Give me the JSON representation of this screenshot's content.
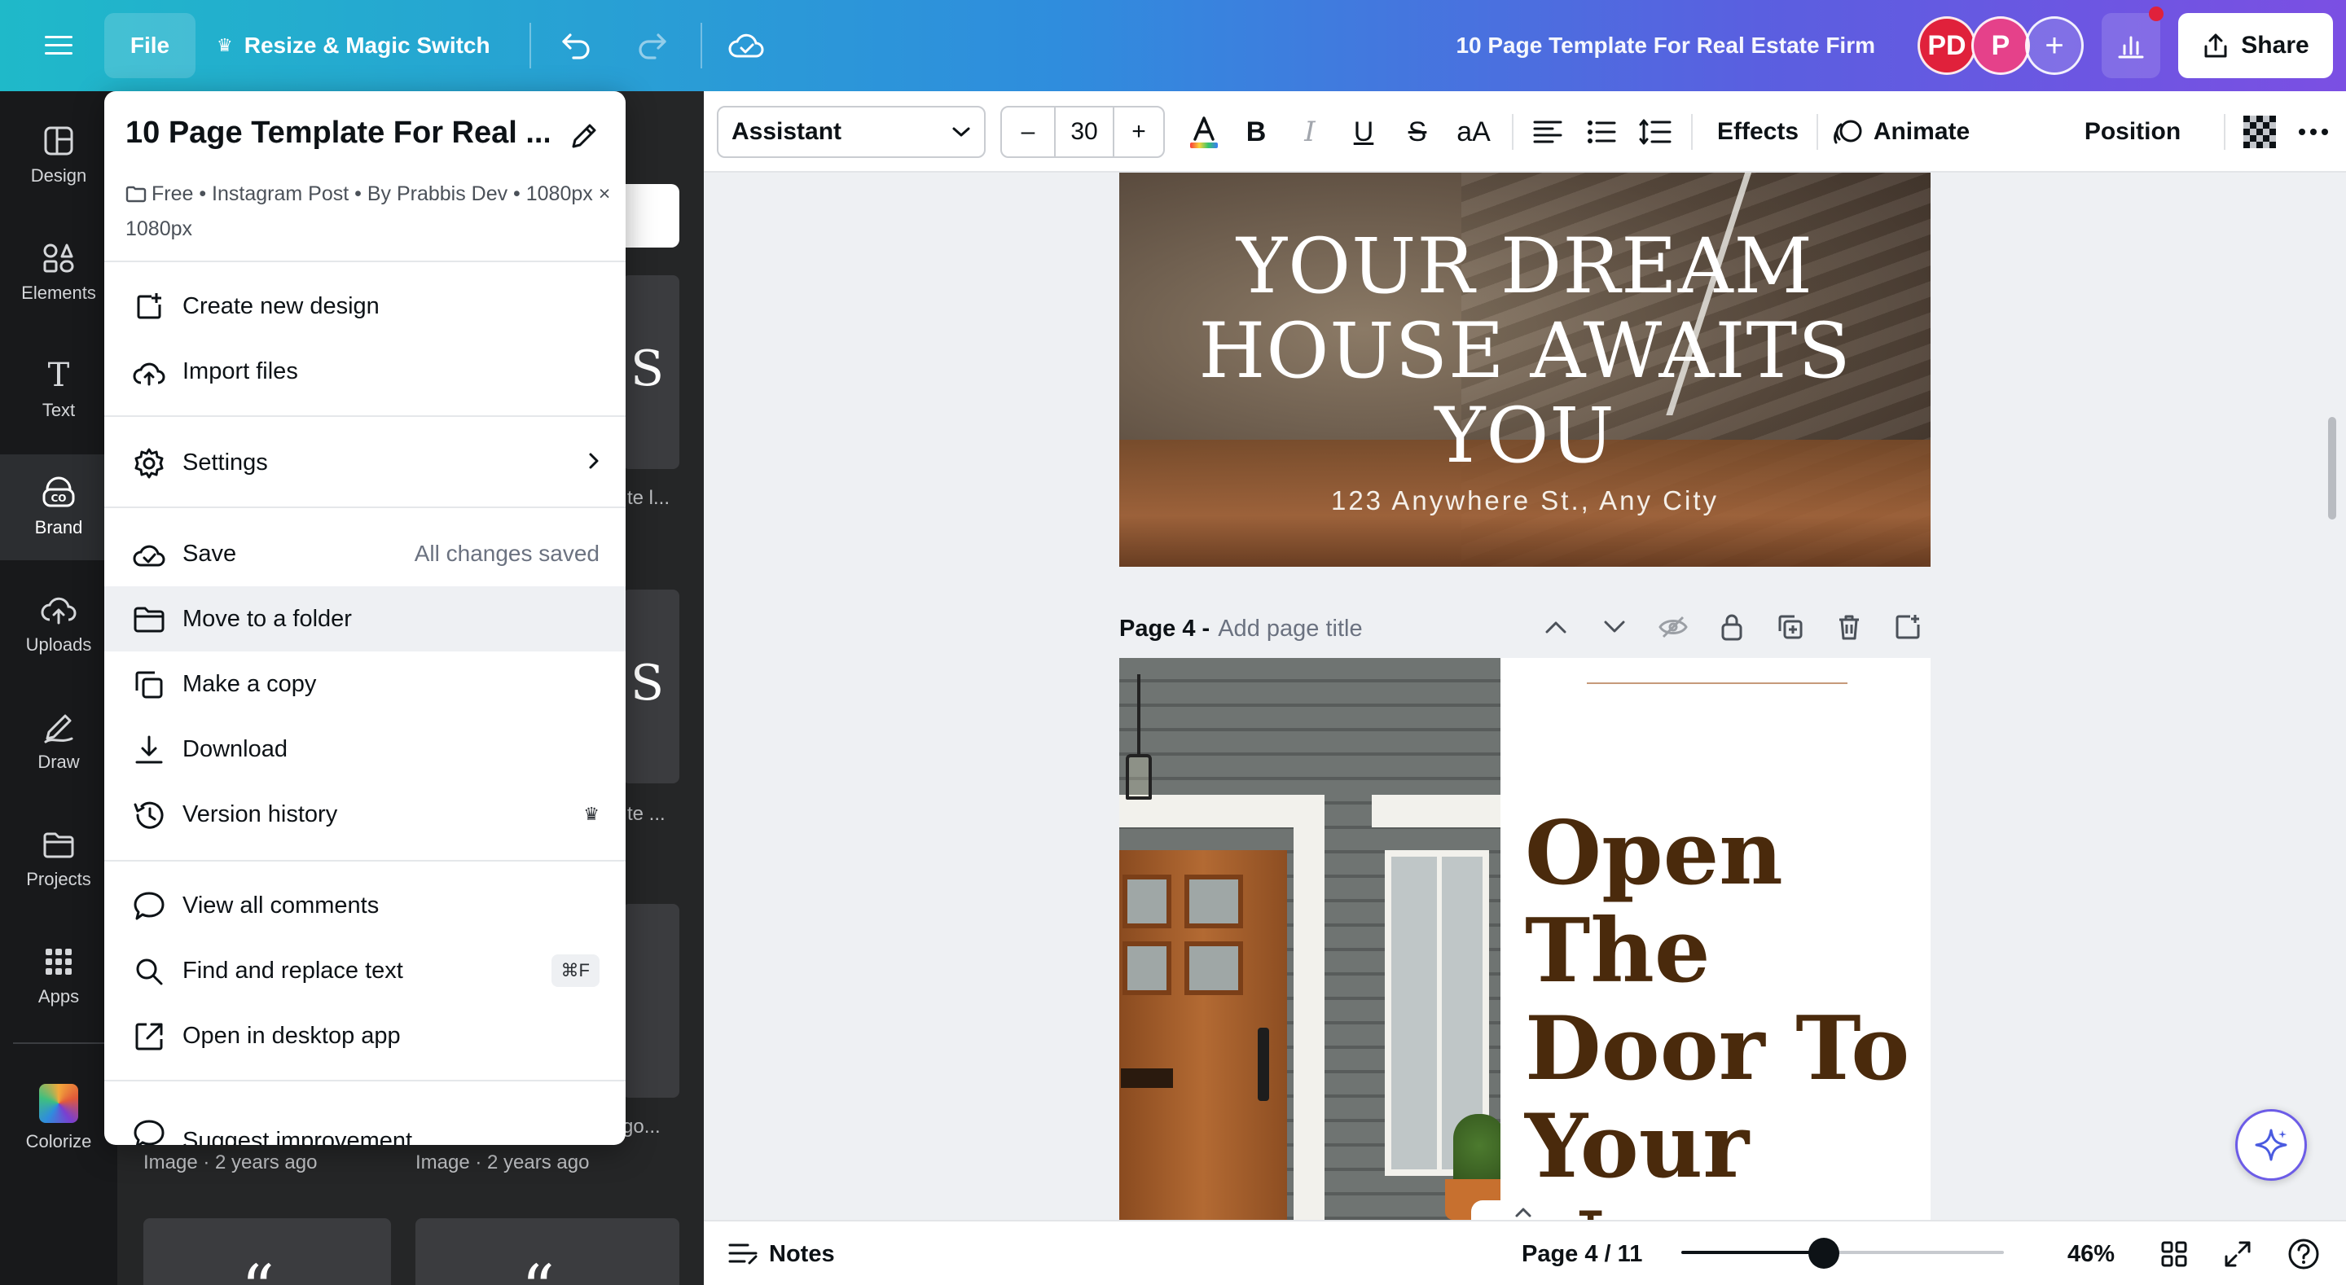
{
  "topbar": {
    "file_label": "File",
    "resize_label": "Resize & Magic Switch",
    "doc_title": "10 Page Template For Real Estate Firm",
    "avatar1": "PD",
    "avatar2": "P",
    "share_label": "Share",
    "colors": {
      "avatar1": "#e0213b",
      "avatar2": "#e5418a",
      "notification_dot": "#e0213b"
    }
  },
  "rail": {
    "items": [
      {
        "label": "Design",
        "icon": "layout-icon"
      },
      {
        "label": "Elements",
        "icon": "shapes-icon"
      },
      {
        "label": "Text",
        "icon": "text-icon"
      },
      {
        "label": "Brand",
        "icon": "brand-icon"
      },
      {
        "label": "Uploads",
        "icon": "cloud-upload-icon"
      },
      {
        "label": "Draw",
        "icon": "pen-icon"
      },
      {
        "label": "Projects",
        "icon": "folder-icon"
      },
      {
        "label": "Apps",
        "icon": "grid-icon"
      }
    ],
    "colorize_label": "Colorize",
    "active": "Brand"
  },
  "sidepanel": {
    "captions": [
      "te l...",
      "te ...",
      "go..."
    ],
    "image_caption_1": "Image · 2 years ago",
    "image_caption_2": "Image · 2 years ago"
  },
  "toolbar": {
    "font": "Assistant",
    "font_size": "30",
    "minus": "–",
    "plus": "+",
    "case_label": "aA",
    "effects_label": "Effects",
    "animate_label": "Animate",
    "position_label": "Position"
  },
  "canvas": {
    "page3": {
      "title": "YOUR DREAM HOUSE AWAITS YOU",
      "address": "123 Anywhere St., Any City"
    },
    "page4": {
      "label": "Page 4 -",
      "title_placeholder": "Add page title",
      "headline": "Open The Door To Your New"
    }
  },
  "filemenu": {
    "title": "10 Page Template For Real ...",
    "meta": "Free • Instagram Post • By Prabbis Dev • 1080px × 1080px",
    "items": {
      "create": "Create new design",
      "import": "Import files",
      "settings": "Settings",
      "save": "Save",
      "save_status": "All changes saved",
      "move": "Move to a folder",
      "copy": "Make a copy",
      "download": "Download",
      "version": "Version history",
      "comments": "View all comments",
      "find": "Find and replace text",
      "find_shortcut": "⌘F",
      "desktop": "Open in desktop app",
      "suggest": "Suggest improvement"
    }
  },
  "bottombar": {
    "notes_label": "Notes",
    "page_indicator": "Page 4 / 11",
    "zoom": "46%",
    "zoom_fraction": 0.46
  }
}
